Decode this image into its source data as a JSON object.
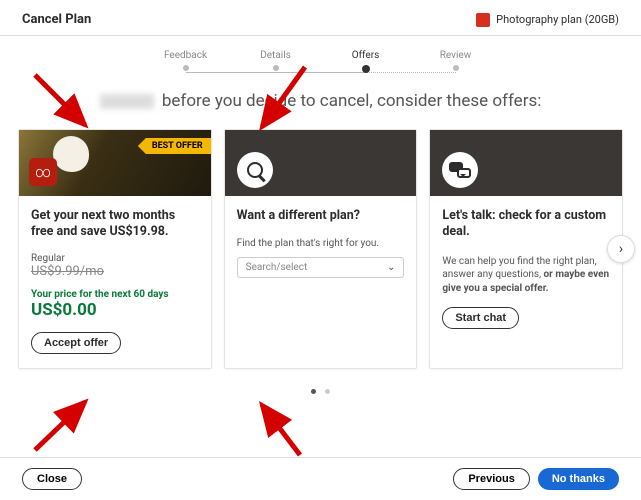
{
  "header": {
    "title": "Cancel Plan",
    "plan_name": "Photography plan (20GB)"
  },
  "stepper": {
    "steps": [
      "Feedback",
      "Details",
      "Offers",
      "Review"
    ],
    "active_index": 2
  },
  "heading_suffix": "before you decide to cancel, consider these offers:",
  "cards": {
    "offer": {
      "badge": "BEST OFFER",
      "title": "Get your next two months free and save US$19.98.",
      "regular_label": "Regular",
      "regular_price": "US$9.99/mo",
      "price_note": "Your price for the next 60 days",
      "price": "US$0.00",
      "cta": "Accept offer"
    },
    "switch": {
      "title": "Want a different plan?",
      "subtitle": "Find the plan that's right for you.",
      "select_placeholder": "Search/select"
    },
    "chat": {
      "title": "Let's talk: check for a custom deal.",
      "help_pre": "We can help you find the right plan, answer any questions, ",
      "help_bold": "or maybe even give you a special offer.",
      "cta": "Start chat"
    }
  },
  "footer": {
    "close": "Close",
    "previous": "Previous",
    "no_thanks": "No thanks"
  }
}
